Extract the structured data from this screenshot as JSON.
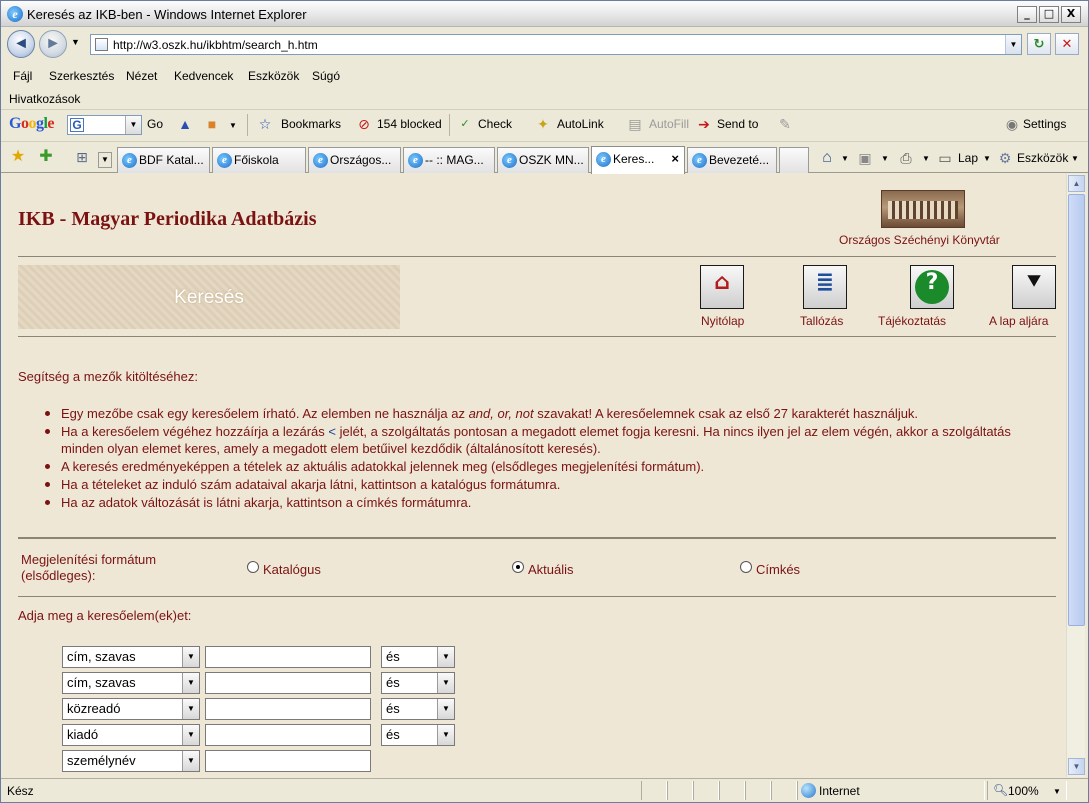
{
  "window": {
    "title": "Keresés az IKB-ben - Windows Internet Explorer",
    "min": "_",
    "max": "□",
    "close": "X"
  },
  "address": {
    "url": "http://w3.oszk.hu/ikbhtm/search_h.htm",
    "back": "◄",
    "forward": "►",
    "dropdown": "▼",
    "refresh": "↻",
    "stop": "✕"
  },
  "menu": [
    "Fájl",
    "Szerkesztés",
    "Nézet",
    "Kedvencek",
    "Eszközök",
    "Súgó"
  ],
  "links_label": "Hivatkozások",
  "google": {
    "logo_letters": [
      "G",
      "o",
      "o",
      "g",
      "l",
      "e"
    ],
    "logo_colors": [
      "#2a5bd7",
      "#d62d20",
      "#f2b50f",
      "#2a5bd7",
      "#129d3b",
      "#d62d20"
    ],
    "badge": "G",
    "go": "Go",
    "bookmarks": "Bookmarks",
    "blocked": "154 blocked",
    "check": "Check",
    "autolink": "AutoLink",
    "autofill": "AutoFill",
    "sendto": "Send to",
    "settings": "Settings"
  },
  "tabs": [
    {
      "label": "BDF Katal...",
      "active": false
    },
    {
      "label": "Főiskola",
      "active": false
    },
    {
      "label": "Országos...",
      "active": false
    },
    {
      "label": "-- :: MAG...",
      "active": false
    },
    {
      "label": "OSZK MN...",
      "active": false
    },
    {
      "label": "Keres...",
      "active": true
    },
    {
      "label": "Bevezeté...",
      "active": false
    }
  ],
  "tab_close": "×",
  "commands": {
    "lap": "Lap",
    "eszkozok": "Eszközök"
  },
  "page": {
    "title": "IKB - Magyar Periodika Adatbázis",
    "library": "Országos Széchényi Könyvtár",
    "banner": "Keresés",
    "nav": [
      {
        "label": "Nyitólap",
        "icon": "⌂",
        "color": "#b51a1a"
      },
      {
        "label": "Tallózás",
        "icon": "≣",
        "color": "#1f4f9c"
      },
      {
        "label": "Tájékoztatás",
        "icon": "?",
        "color": "#1a8a2a"
      },
      {
        "label": "A lap aljára",
        "icon": "⯆",
        "color": "#111111"
      }
    ],
    "help_title": "Segítség a mezők kitöltéséhez:",
    "help": {
      "i1_a": "Egy mezőbe csak egy keresőelem írható. Az elemben ne használja az ",
      "i1_em": "and, or, not",
      "i1_b": " szavakat! A keresőelemnek csak az első 27 karakterét használjuk.",
      "i2_a": "Ha a keresőelem végéhez hozzáírja a lezárás ",
      "i2_sym": "<",
      "i2_b": " jelét, a szolgáltatás pontosan a megadott elemet fogja keresni. Ha nincs ilyen jel az elem végén, akkor a szolgáltatás minden olyan elemet keres, amely a megadott elem betűivel kezdődik (általánosított keresés).",
      "i3": "A keresés eredményeképpen a tételek az aktuális adatokkal jelennek meg (elsődleges megjelenítési formátum).",
      "i4": "Ha a tételeket az induló szám adataival akarja látni, kattintson a katalógus formátumra.",
      "i5": "Ha az adatok változását is látni akarja, kattintson a címkés formátumra."
    },
    "format_label_1": "Megjelenítési formátum",
    "format_label_2": "(elsődleges):",
    "formats": [
      {
        "label": "Katalógus",
        "selected": false
      },
      {
        "label": "Aktuális",
        "selected": true
      },
      {
        "label": "Címkés",
        "selected": false
      }
    ],
    "search_prompt": "Adja meg a keresőelem(ek)et:",
    "rows": [
      {
        "field": "cím, szavas",
        "value": "",
        "op": "és"
      },
      {
        "field": "cím, szavas",
        "value": "",
        "op": "és"
      },
      {
        "field": "közreadó",
        "value": "",
        "op": "és"
      },
      {
        "field": "kiadó",
        "value": "",
        "op": "és"
      },
      {
        "field": "személynév",
        "value": "",
        "op": ""
      }
    ]
  },
  "status": {
    "ready": "Kész",
    "zone": "Internet",
    "zoom": "100%"
  }
}
